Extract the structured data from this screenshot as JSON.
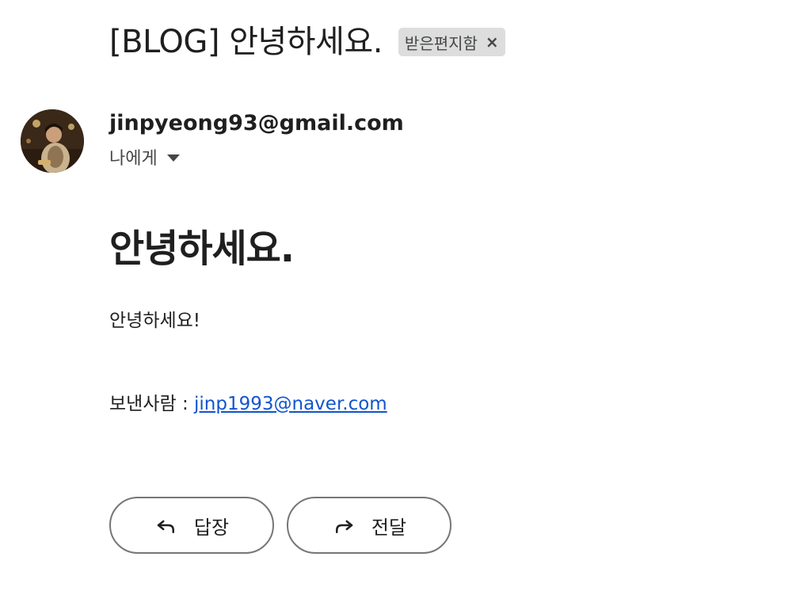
{
  "email": {
    "subject": "[BLOG] 안녕하세요.",
    "label": "받은편지함",
    "label_remove_glyph": "×",
    "sender_email": "jinpyeong93@gmail.com",
    "recipient": "나에게",
    "body_heading": "안녕하세요.",
    "body_text": "안녕하세요!",
    "from_prefix": "보낸사람 : ",
    "from_link": "jinp1993@naver.com"
  },
  "actions": {
    "reply_label": "답장",
    "forward_label": "전달"
  },
  "icons": {
    "reply": "reply-arrow-icon",
    "forward": "forward-arrow-icon",
    "caret": "chevron-down-icon",
    "remove": "close-icon"
  },
  "colors": {
    "link": "#1155cc",
    "chip_bg": "#dddddd",
    "button_border": "#747775"
  }
}
